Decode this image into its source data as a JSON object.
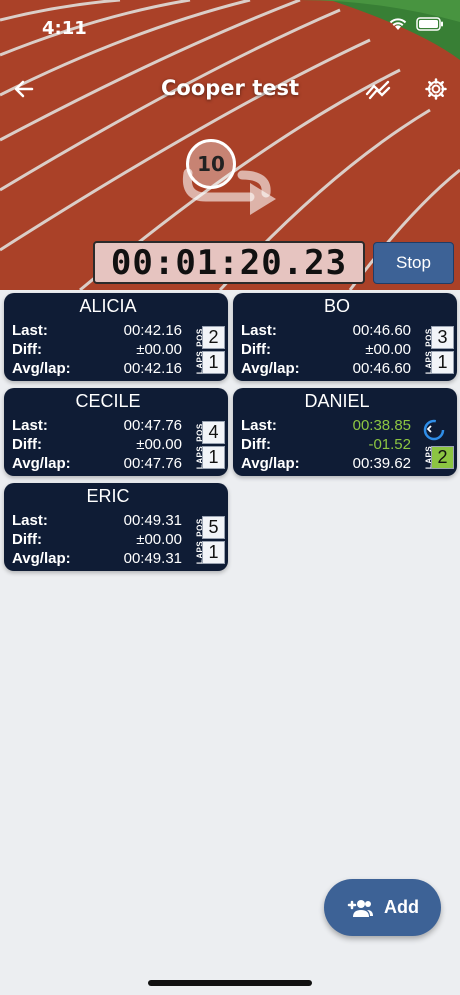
{
  "status_bar": {
    "time": "4:11"
  },
  "header": {
    "title": "Cooper test"
  },
  "lap_target": {
    "count": "10"
  },
  "timer": {
    "value": "00:01:20.23"
  },
  "controls": {
    "stop_label": "Stop",
    "add_label": "Add"
  },
  "card_labels": {
    "last": "Last:",
    "diff": "Diff:",
    "avg": "Avg/lap:",
    "pos": "POS",
    "laps": "LAPS"
  },
  "runners": [
    {
      "name": "ALICIA",
      "last": "00:42.16",
      "diff": "±00.00",
      "avg": "00:42.16",
      "pos": "2",
      "laps": "1"
    },
    {
      "name": "BO",
      "last": "00:46.60",
      "diff": "±00.00",
      "avg": "00:46.60",
      "pos": "3",
      "laps": "1"
    },
    {
      "name": "CECILE",
      "last": "00:47.76",
      "diff": "±00.00",
      "avg": "00:47.76",
      "pos": "4",
      "laps": "1"
    },
    {
      "name": "DANIEL",
      "last": "00:38.85",
      "diff": "-01.52",
      "avg": "00:39.62",
      "pos": "",
      "laps": "2"
    },
    {
      "name": "ERIC",
      "last": "00:49.31",
      "diff": "±00.00",
      "avg": "00:49.31",
      "pos": "5",
      "laps": "1"
    }
  ],
  "colors": {
    "card_bg": "#0f1c35",
    "accent": "#3d6296",
    "improved": "#8cc542",
    "spinner": "#2f8ee8"
  }
}
